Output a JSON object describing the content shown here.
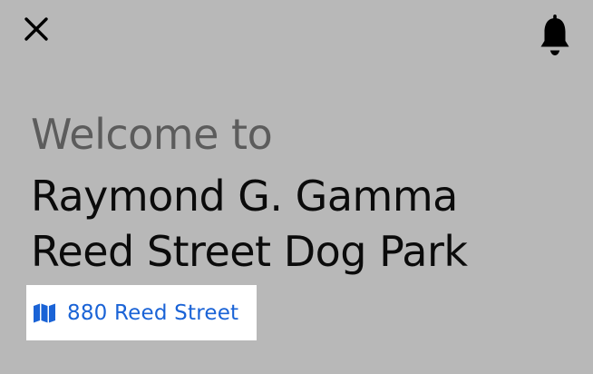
{
  "header": {
    "close_icon": "close-icon",
    "notification_icon": "bell-icon"
  },
  "hero": {
    "welcome_text": "Welcome to",
    "park_name_line1": "Raymond G. Gamma",
    "park_name_line2": "Reed Street Dog Park"
  },
  "address": {
    "icon": "map-icon",
    "text": "880 Reed Street",
    "color": "#1a63d6"
  },
  "colors": {
    "background": "#b8b8b8",
    "welcome": "#5c5c5c",
    "title": "#0b0b0b",
    "chip_background": "#ffffff"
  }
}
